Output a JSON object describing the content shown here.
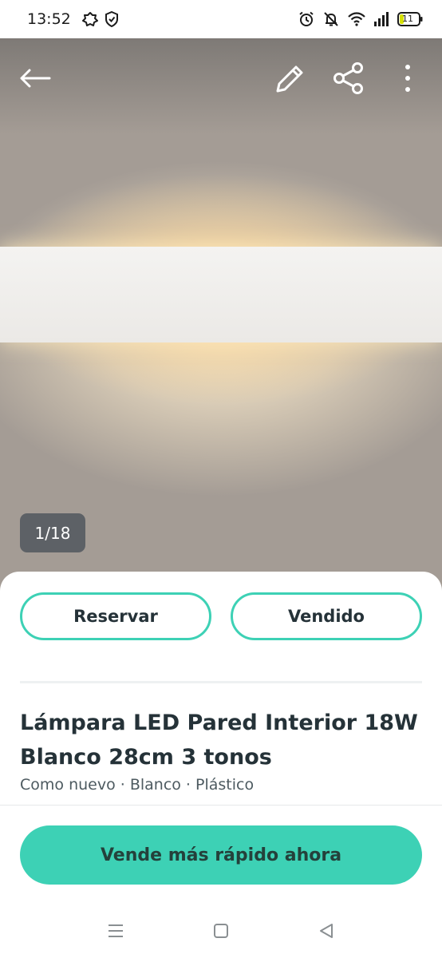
{
  "status_bar": {
    "time": "13:52",
    "battery": "11",
    "left_icons": [
      "cloud-icon",
      "shield-check-icon"
    ],
    "right_icons": [
      "alarm-icon",
      "bell-off-icon",
      "wifi-icon",
      "signal-icon",
      "battery-icon"
    ]
  },
  "photo": {
    "counter": "1/18"
  },
  "toolbar": {
    "icons": [
      "arrow-left-icon",
      "pencil-icon",
      "share-icon",
      "more-vertical-icon"
    ]
  },
  "actions": {
    "reserve_label": "Reservar",
    "sold_label": "Vendido"
  },
  "product": {
    "title": "Lámpara LED Pared Interior 18W Blanco 28cm 3 tonos",
    "meta": "Como nuevo · Blanco · Plástico"
  },
  "promo": {
    "cta_label": "Vende más rápido ahora"
  },
  "colors": {
    "accent": "#3dd1b5",
    "text_dark": "#253238",
    "counter_bg": "#5d6166"
  },
  "nav": {
    "icons": [
      "menu-icon",
      "home-square-icon",
      "back-triangle-icon"
    ]
  }
}
